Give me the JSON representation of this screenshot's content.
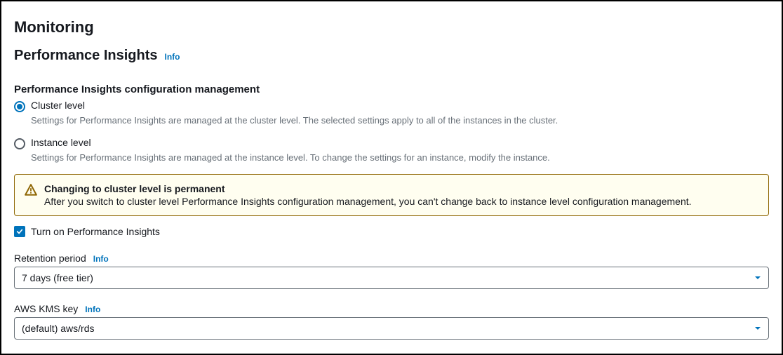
{
  "header": {
    "title": "Monitoring"
  },
  "subheader": {
    "title": "Performance Insights",
    "info": "Info"
  },
  "config": {
    "section_label": "Performance Insights configuration management",
    "options": {
      "cluster": {
        "label": "Cluster level",
        "desc": "Settings for Performance Insights are managed at the cluster level. The selected settings apply to all of the instances in the cluster."
      },
      "instance": {
        "label": "Instance level",
        "desc": "Settings for Performance Insights are managed at the instance level. To change the settings for an instance, modify the instance."
      }
    }
  },
  "alert": {
    "title": "Changing to cluster level is permanent",
    "body": "After you switch to cluster level Performance Insights configuration management, you can't change back to instance level configuration management."
  },
  "toggle": {
    "label": "Turn on Performance Insights"
  },
  "retention": {
    "label": "Retention period",
    "info": "Info",
    "value": "7 days (free tier)"
  },
  "kms": {
    "label": "AWS KMS key",
    "info": "Info",
    "value": "(default) aws/rds"
  }
}
